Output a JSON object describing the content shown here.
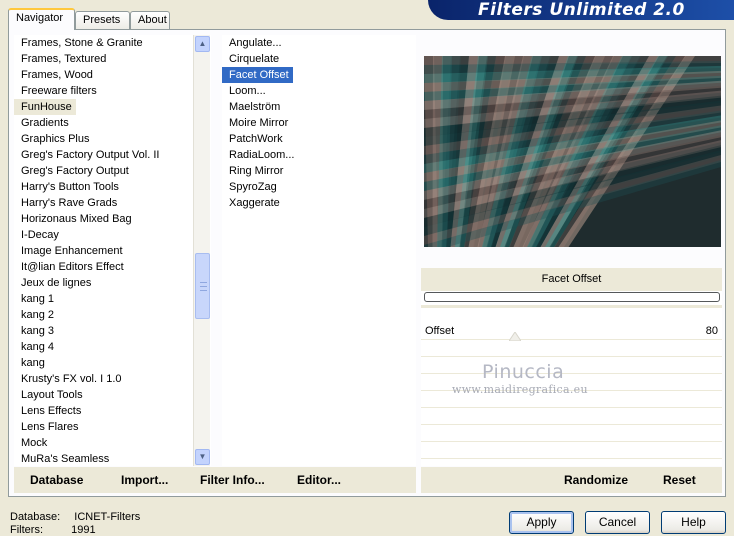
{
  "banner": {
    "title": "Filters Unlimited 2.0"
  },
  "tabs": [
    {
      "label": "Navigator"
    },
    {
      "label": "Presets"
    },
    {
      "label": "About"
    }
  ],
  "categories": {
    "items": [
      "Frames, Stone & Granite",
      "Frames, Textured",
      "Frames, Wood",
      "Freeware filters",
      "FunHouse",
      "Gradients",
      "Graphics Plus",
      "Greg's Factory Output Vol. II",
      "Greg's Factory Output",
      "Harry's Button Tools",
      "Harry's Rave Grads",
      "Horizonaus Mixed Bag",
      "I-Decay",
      "Image Enhancement",
      "It@lian Editors Effect",
      "Jeux de lignes",
      "kang 1",
      "kang 2",
      "kang 3",
      "kang 4",
      "kang",
      "Krusty's FX vol. I 1.0",
      "Layout Tools",
      "Lens Effects",
      "Lens Flares",
      "Mock",
      "MuRa's Seamless"
    ],
    "selected": "FunHouse"
  },
  "filters": {
    "items": [
      "Angulate...",
      "Cirquelate",
      "Facet Offset",
      "Loom...",
      "Maelström",
      "Moire Mirror",
      "PatchWork",
      "RadiaLoom...",
      "Ring Mirror",
      "SpyroZag",
      "Xaggerate"
    ],
    "selected": "Facet Offset"
  },
  "preview": {
    "filter_name": "Facet Offset"
  },
  "params": [
    {
      "label": "Offset",
      "value": "80"
    }
  ],
  "watermark": {
    "name": "Pinuccia",
    "site": "www.maidiregrafica.eu"
  },
  "buttons_left": [
    {
      "label": "Database"
    },
    {
      "label": "Import..."
    },
    {
      "label": "Filter Info..."
    },
    {
      "label": "Editor..."
    }
  ],
  "buttons_right": {
    "randomize": "Randomize",
    "reset": "Reset"
  },
  "status": {
    "database_label": "Database:",
    "database_value": "ICNET-Filters",
    "filters_label": "Filters:",
    "filters_value": "1991"
  },
  "dialog_buttons": {
    "apply": "Apply",
    "cancel": "Cancel",
    "help": "Help"
  },
  "colors": {
    "selection": "#316ac5",
    "banner": "#0a246a",
    "face": "#ece9d8"
  }
}
